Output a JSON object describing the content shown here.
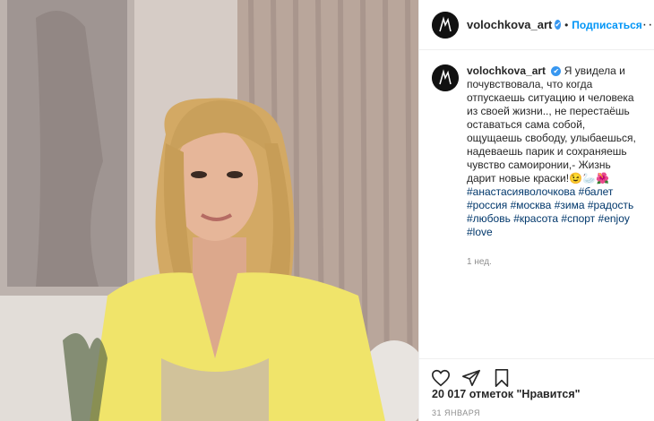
{
  "post": {
    "username": "volochkova_art",
    "verified_mark": "✔",
    "dot": "•",
    "follow_label": "Подписаться",
    "more_label": "···",
    "caption_user": "volochkova_art",
    "caption_text": "Я увидела и почувствовала, что когда отпускаешь ситуацию и человека из своей жизни.., не перестаёшь оставаться сама собой, ощущаешь свободу, улыбаешься, надеваешь парик и сохраняешь чувство самоиронии,- Жизнь дарит новые краски!😉🦢🌺",
    "hashtags": [
      "#анастасияволочкова",
      "#балет",
      "#россия",
      "#москва",
      "#зима",
      "#радость",
      "#любовь",
      "#красота",
      "#спорт",
      "#enjoy",
      "#love"
    ],
    "time_ago": "1 нед.",
    "likes": "20 017 отметок \"Нравится\"",
    "date": "31 ЯНВАРЯ"
  },
  "icons": {
    "like": "heart-icon",
    "share": "paper-plane-icon",
    "save": "bookmark-icon",
    "verified": "verified-badge-icon",
    "more": "more-dots-icon"
  },
  "colors": {
    "accent": "#0095f6",
    "verified": "#3897f0",
    "hashtag": "#00376b",
    "muted": "#8e8e8e",
    "top_color": "#f0e46a"
  }
}
